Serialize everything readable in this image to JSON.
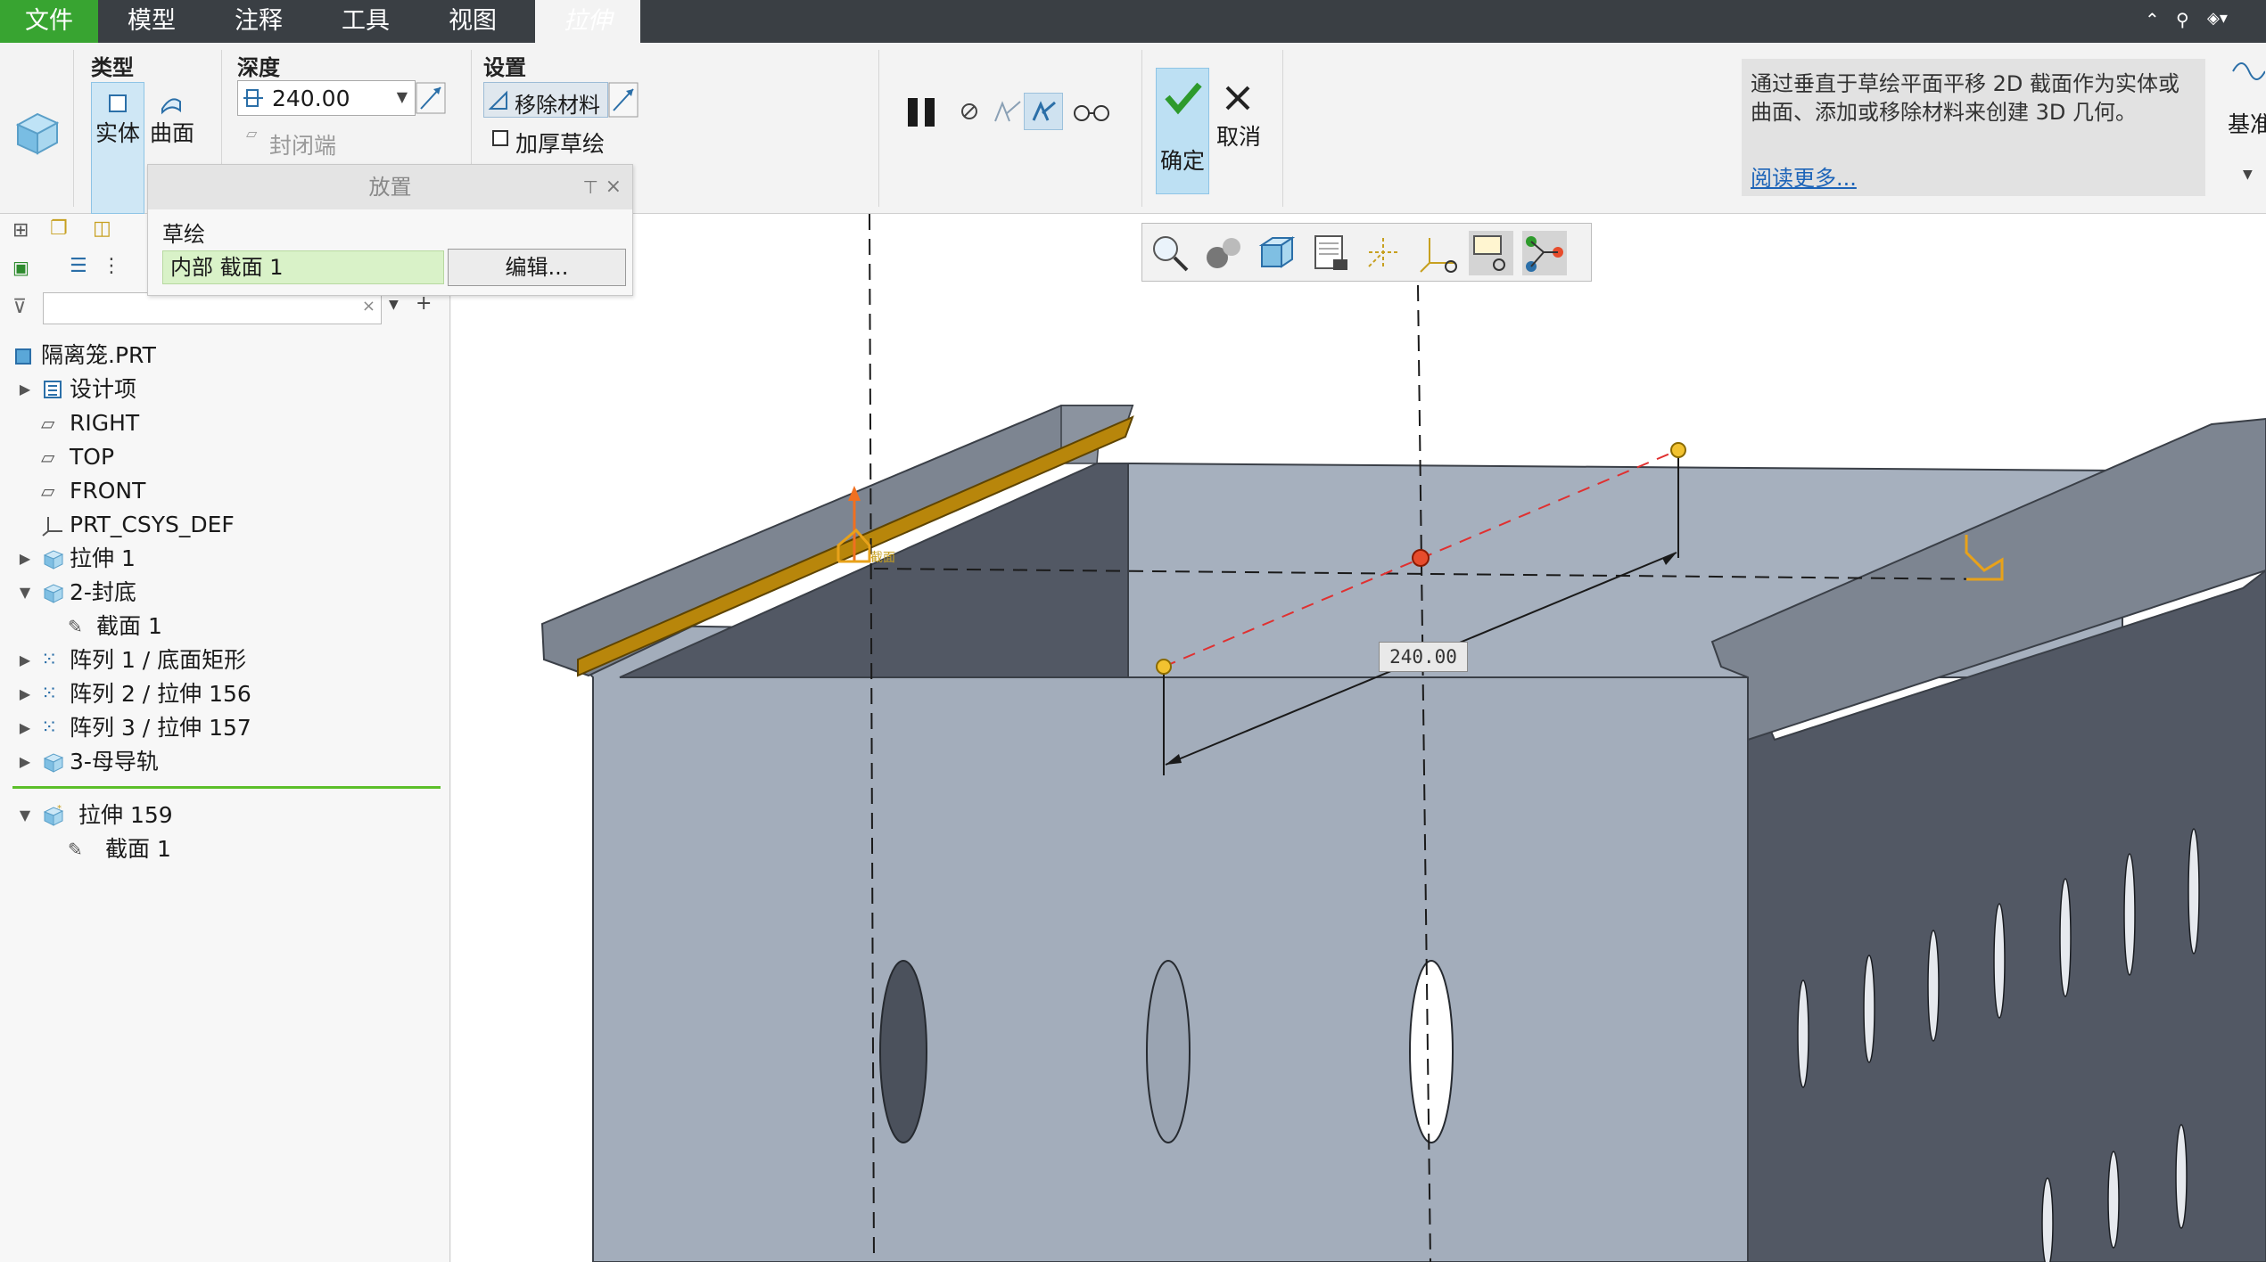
{
  "tabs": {
    "file": "文件",
    "model": "模型",
    "annotate": "注释",
    "tools": "工具",
    "view": "视图",
    "extrude": "拉伸"
  },
  "ribbon": {
    "type_group": {
      "title": "类型",
      "solid": "实体",
      "surface": "曲面"
    },
    "depth_group": {
      "title": "深度",
      "value": "240.00",
      "capped_ends": "封闭端"
    },
    "settings_group": {
      "title": "设置",
      "remove_material": "移除材料",
      "thicken_sketch": "加厚草绘"
    },
    "ok": "确定",
    "cancel": "取消",
    "datum": "基准"
  },
  "placement_panel": {
    "title": "放置",
    "sketch_label": "草绘",
    "sketch_value": "内部 截面 1",
    "edit_button": "编辑..."
  },
  "help": {
    "text": "通过垂直于草绘平面平移 2D 截面作为实体或曲面、添加或移除材料来创建 3D 几何。",
    "link": "阅读更多..."
  },
  "model_tree": {
    "root": "隔离笼.PRT",
    "items": [
      {
        "label": "设计项"
      },
      {
        "label": "RIGHT"
      },
      {
        "label": "TOP"
      },
      {
        "label": "FRONT"
      },
      {
        "label": "PRT_CSYS_DEF"
      },
      {
        "label": "拉伸 1"
      },
      {
        "label": "2-封底"
      },
      {
        "label": "截面 1"
      },
      {
        "label": "阵列 1 / 底面矩形"
      },
      {
        "label": "阵列 2 / 拉伸 156"
      },
      {
        "label": "阵列 3 / 拉伸 157"
      },
      {
        "label": "3-母导轨"
      },
      {
        "label": "拉伸 159"
      },
      {
        "label": "截面 1"
      }
    ]
  },
  "viewport": {
    "dimension": "240.00",
    "sketch_tag": "截面"
  },
  "colors": {
    "file_tab": "#38a431",
    "tabbar": "#3a3f44",
    "model_face_light": "#a3adbb",
    "model_face_dark": "#525864",
    "model_face_mid": "#7d8591",
    "preview_solid": "#b8860b",
    "link": "#1d64b8"
  }
}
